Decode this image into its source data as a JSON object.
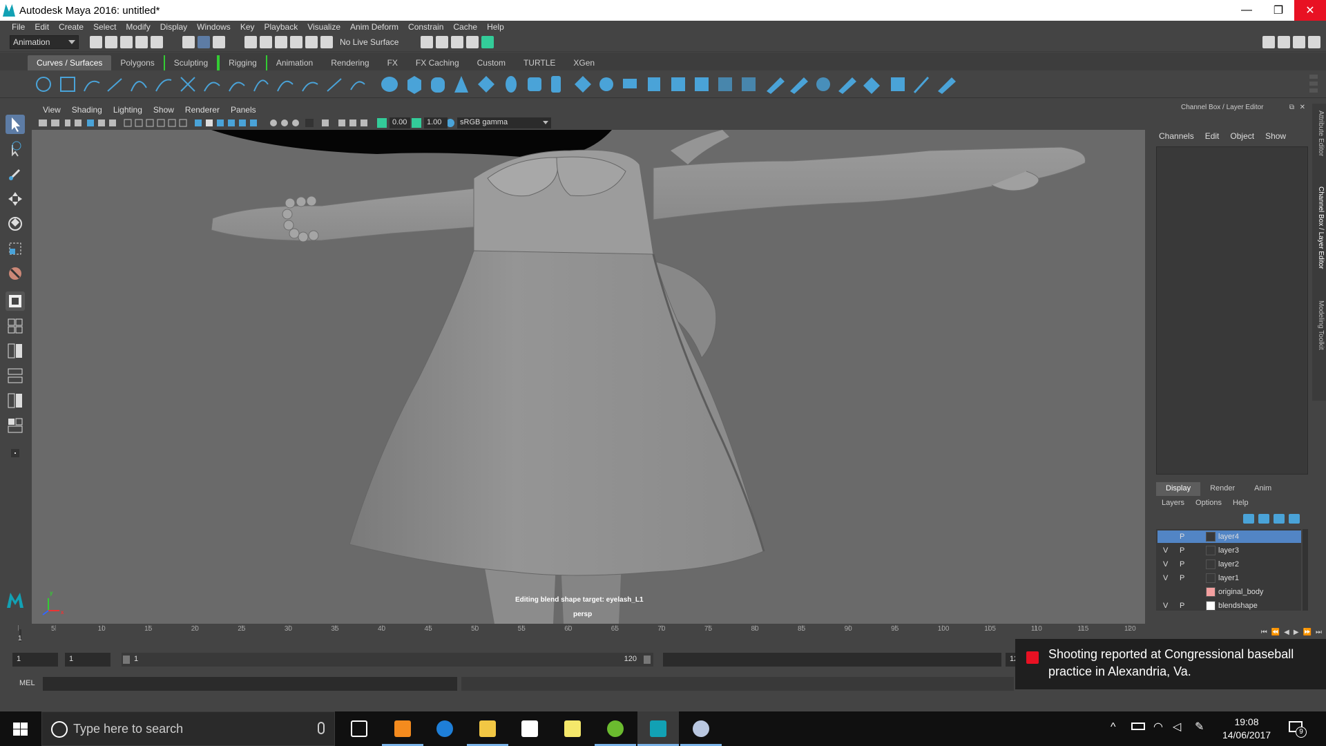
{
  "window": {
    "title": "Autodesk Maya 2016: untitled*",
    "minimize": "—",
    "restore": "❐",
    "close": "✕"
  },
  "menubar": [
    "File",
    "Edit",
    "Create",
    "Select",
    "Modify",
    "Display",
    "Windows",
    "Key",
    "Playback",
    "Visualize",
    "Anim Deform",
    "Constrain",
    "Cache",
    "Help"
  ],
  "statusline": {
    "mode": "Animation",
    "live_surface": "No Live Surface"
  },
  "shelf_tabs": [
    "Curves / Surfaces",
    "Polygons",
    "Sculpting",
    "Rigging",
    "Animation",
    "Rendering",
    "FX",
    "FX Caching",
    "Custom",
    "TURTLE",
    "XGen"
  ],
  "shelf_active_tab": "Curves / Surfaces",
  "panel_menu": [
    "View",
    "Shading",
    "Lighting",
    "Show",
    "Renderer",
    "Panels"
  ],
  "panel_toolbar": {
    "exposure": "0.00",
    "gamma": "1.00",
    "colorspace": "sRGB gamma"
  },
  "viewport": {
    "hud_message": "Editing blend shape target: eyelash_L1",
    "camera": "persp",
    "axis_y": "y",
    "axis_x": "x"
  },
  "channel_box": {
    "header": "Channel Box / Layer Editor",
    "menu": [
      "Channels",
      "Edit",
      "Object",
      "Show"
    ]
  },
  "layer_editor": {
    "tabs": [
      "Display",
      "Render",
      "Anim"
    ],
    "active_tab": "Display",
    "menu": [
      "Layers",
      "Options",
      "Help"
    ],
    "layers": [
      {
        "v": "",
        "p": "P",
        "name": "layer4",
        "selected": true,
        "color": ""
      },
      {
        "v": "V",
        "p": "P",
        "name": "layer3",
        "selected": false,
        "color": ""
      },
      {
        "v": "V",
        "p": "P",
        "name": "layer2",
        "selected": false,
        "color": ""
      },
      {
        "v": "V",
        "p": "P",
        "name": "layer1",
        "selected": false,
        "color": ""
      },
      {
        "v": "",
        "p": "",
        "name": "original_body",
        "selected": false,
        "color": "#f4a0a0"
      },
      {
        "v": "V",
        "p": "P",
        "name": "blendshape",
        "selected": false,
        "color": "#ffffff"
      }
    ]
  },
  "side_tabs": [
    "Attribute Editor",
    "Channel Box / Layer Editor",
    "Modeling Toolkit"
  ],
  "timeline": {
    "ticks": [
      "1",
      "5",
      "10",
      "15",
      "20",
      "25",
      "30",
      "35",
      "40",
      "45",
      "50",
      "55",
      "60",
      "65",
      "70",
      "75",
      "80",
      "85",
      "90",
      "95",
      "100",
      "105",
      "110",
      "115",
      "120"
    ],
    "current_frame": "1"
  },
  "range": {
    "start": "1",
    "start_inner": "1",
    "slider_start": "1",
    "slider_end": "120",
    "end_partial": "12"
  },
  "command_line": {
    "label": "MEL"
  },
  "notification": {
    "text": "Shooting reported at Congressional baseball practice in Alexandria, Va."
  },
  "taskbar": {
    "search_placeholder": "Type here to search",
    "time": "19:08",
    "date": "14/06/2017",
    "notification_count": "9"
  },
  "colors": {
    "maya_accent": "#12a1b4",
    "selection_blue": "#5285c5",
    "shelf_icon_blue": "#4aa3d8",
    "close_red": "#e81123"
  }
}
